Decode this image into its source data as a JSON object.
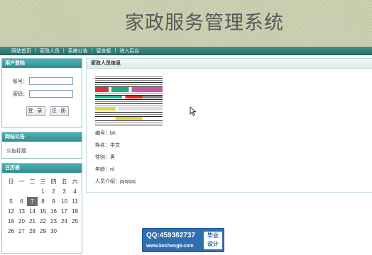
{
  "header": {
    "title": "家政服务管理系统"
  },
  "nav": {
    "items": [
      {
        "label": "网站首页"
      },
      {
        "label": "家政人员"
      },
      {
        "label": "系统公告"
      },
      {
        "label": "留言板"
      },
      {
        "label": "进入后台"
      }
    ],
    "separator": "|"
  },
  "login": {
    "title": "用户登陆",
    "username_label": "账号：",
    "password_label": "密码：",
    "username_value": "",
    "password_value": "",
    "login_button": "登 录",
    "register_button": "注 册"
  },
  "notice": {
    "title": "网站公告",
    "text": "公告标题"
  },
  "calendar": {
    "title": "日历表",
    "weekdays": [
      "日",
      "一",
      "二",
      "三",
      "四",
      "五",
      "六"
    ],
    "today": "7",
    "rows": [
      [
        "",
        "",
        "",
        "",
        "1",
        "2",
        "3",
        "4"
      ],
      [
        "5",
        "6",
        "7",
        "8",
        "9",
        "10",
        "11"
      ],
      [
        "12",
        "13",
        "14",
        "15",
        "16",
        "17",
        "18"
      ],
      [
        "19",
        "20",
        "21",
        "22",
        "23",
        "24",
        "25"
      ],
      [
        "26",
        "27",
        "28",
        "29",
        "30",
        "",
        ""
      ]
    ]
  },
  "content": {
    "title": "家政人员信息",
    "fields": [
      {
        "text": "编号：bh"
      },
      {
        "text": "姓名：中文"
      },
      {
        "text": "性别：男"
      },
      {
        "text": "年龄：nl"
      },
      {
        "text": "人员介绍：jsjsjsjsj"
      }
    ]
  },
  "watermark": {
    "qq": "QQ:459382737",
    "url": "www.kecheng8.com",
    "badge_line1": "毕业",
    "badge_line2": "设计"
  },
  "colors": {
    "nav_bg": "#2b6f69",
    "panel_head": "#3a9ca1",
    "today_bg": "#6d6d6d",
    "watermark_bg": "#2f6fb0"
  }
}
